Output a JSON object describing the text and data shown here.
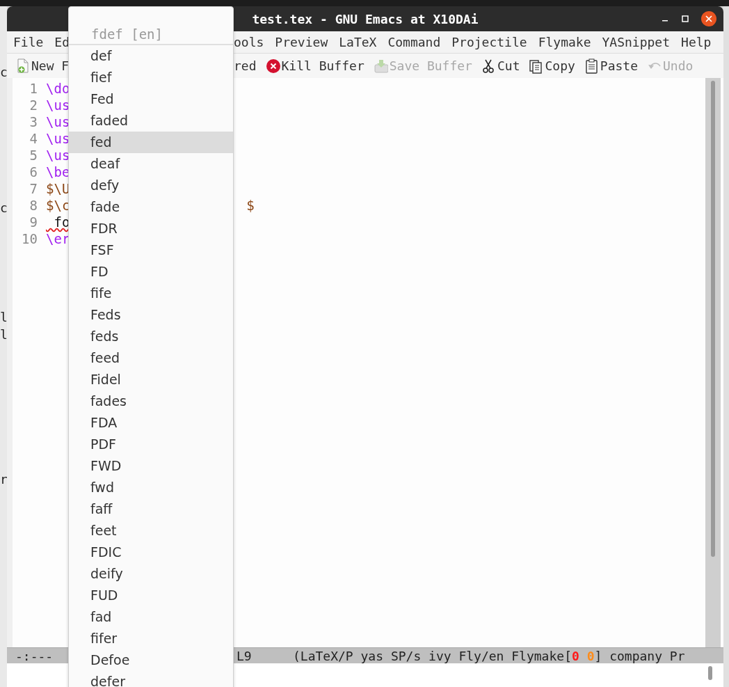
{
  "background_fragments": [
    "c",
    "c",
    "l",
    "l",
    "r"
  ],
  "window": {
    "title": "test.tex - GNU Emacs at X10DAi"
  },
  "menu_bar": {
    "left": [
      "File",
      "Ed"
    ],
    "right": [
      "ools",
      "Preview",
      "LaTeX",
      "Command",
      "Projectile",
      "Flymake",
      "YASnippet",
      "Help"
    ]
  },
  "toolbar": {
    "left": [
      {
        "label": "New F",
        "disabled": false
      }
    ],
    "right": [
      {
        "label": "red",
        "disabled": false
      },
      {
        "label": "Kill Buffer",
        "disabled": false
      },
      {
        "label": "Save Buffer",
        "disabled": true
      },
      {
        "label": "Cut",
        "disabled": false
      },
      {
        "label": "Copy",
        "disabled": false
      },
      {
        "label": "Paste",
        "disabled": false
      },
      {
        "label": "Undo",
        "disabled": true
      }
    ]
  },
  "editor": {
    "lines": [
      {
        "number": "1",
        "text": "\\do",
        "kind": "command"
      },
      {
        "number": "2",
        "text": "\\us",
        "kind": "command"
      },
      {
        "number": "3",
        "text": "\\us",
        "kind": "command"
      },
      {
        "number": "4",
        "text": "\\us",
        "kind": "command"
      },
      {
        "number": "5",
        "text": "\\us",
        "kind": "command"
      },
      {
        "number": "6",
        "text": "\\be",
        "kind": "command"
      },
      {
        "number": "7",
        "text": "$\\U",
        "kind": "math"
      },
      {
        "number": "8",
        "text": "$\\c",
        "kind": "math",
        "tail": "$"
      },
      {
        "number": "9",
        "text": " fo",
        "kind": "plain",
        "misspelled": true
      },
      {
        "number": "10",
        "text": "\\er",
        "kind": "command"
      }
    ]
  },
  "completion_popup": {
    "header": "fdef [en]",
    "items": [
      {
        "text": "def",
        "selected": false
      },
      {
        "text": "fief",
        "selected": false
      },
      {
        "text": "Fed",
        "selected": false
      },
      {
        "text": "faded",
        "selected": false
      },
      {
        "text": "fed",
        "selected": true
      },
      {
        "text": "deaf",
        "selected": false
      },
      {
        "text": "defy",
        "selected": false
      },
      {
        "text": "fade",
        "selected": false
      },
      {
        "text": "FDR",
        "selected": false
      },
      {
        "text": "FSF",
        "selected": false
      },
      {
        "text": "FD",
        "selected": false
      },
      {
        "text": "fife",
        "selected": false
      },
      {
        "text": "Feds",
        "selected": false
      },
      {
        "text": "feds",
        "selected": false
      },
      {
        "text": "feed",
        "selected": false
      },
      {
        "text": "Fidel",
        "selected": false
      },
      {
        "text": "fades",
        "selected": false
      },
      {
        "text": "FDA",
        "selected": false
      },
      {
        "text": "PDF",
        "selected": false
      },
      {
        "text": "FWD",
        "selected": false
      },
      {
        "text": "fwd",
        "selected": false
      },
      {
        "text": "faff",
        "selected": false
      },
      {
        "text": "feet",
        "selected": false
      },
      {
        "text": "FDIC",
        "selected": false
      },
      {
        "text": "deify",
        "selected": false
      },
      {
        "text": "FUD",
        "selected": false
      },
      {
        "text": "fad",
        "selected": false
      },
      {
        "text": "fifer",
        "selected": false
      },
      {
        "text": "Defoe",
        "selected": false
      },
      {
        "text": "defer",
        "selected": false
      }
    ]
  },
  "mode_line": {
    "status": "-:---",
    "position": "L9",
    "segments": [
      {
        "text": "(LaTeX/P yas SP/s ivy Fly/en Flymake[",
        "kind": "plain"
      },
      {
        "text": "0",
        "kind": "error"
      },
      {
        "text": "0",
        "kind": "warning"
      },
      {
        "text": "] company Pr",
        "kind": "plain"
      }
    ]
  }
}
